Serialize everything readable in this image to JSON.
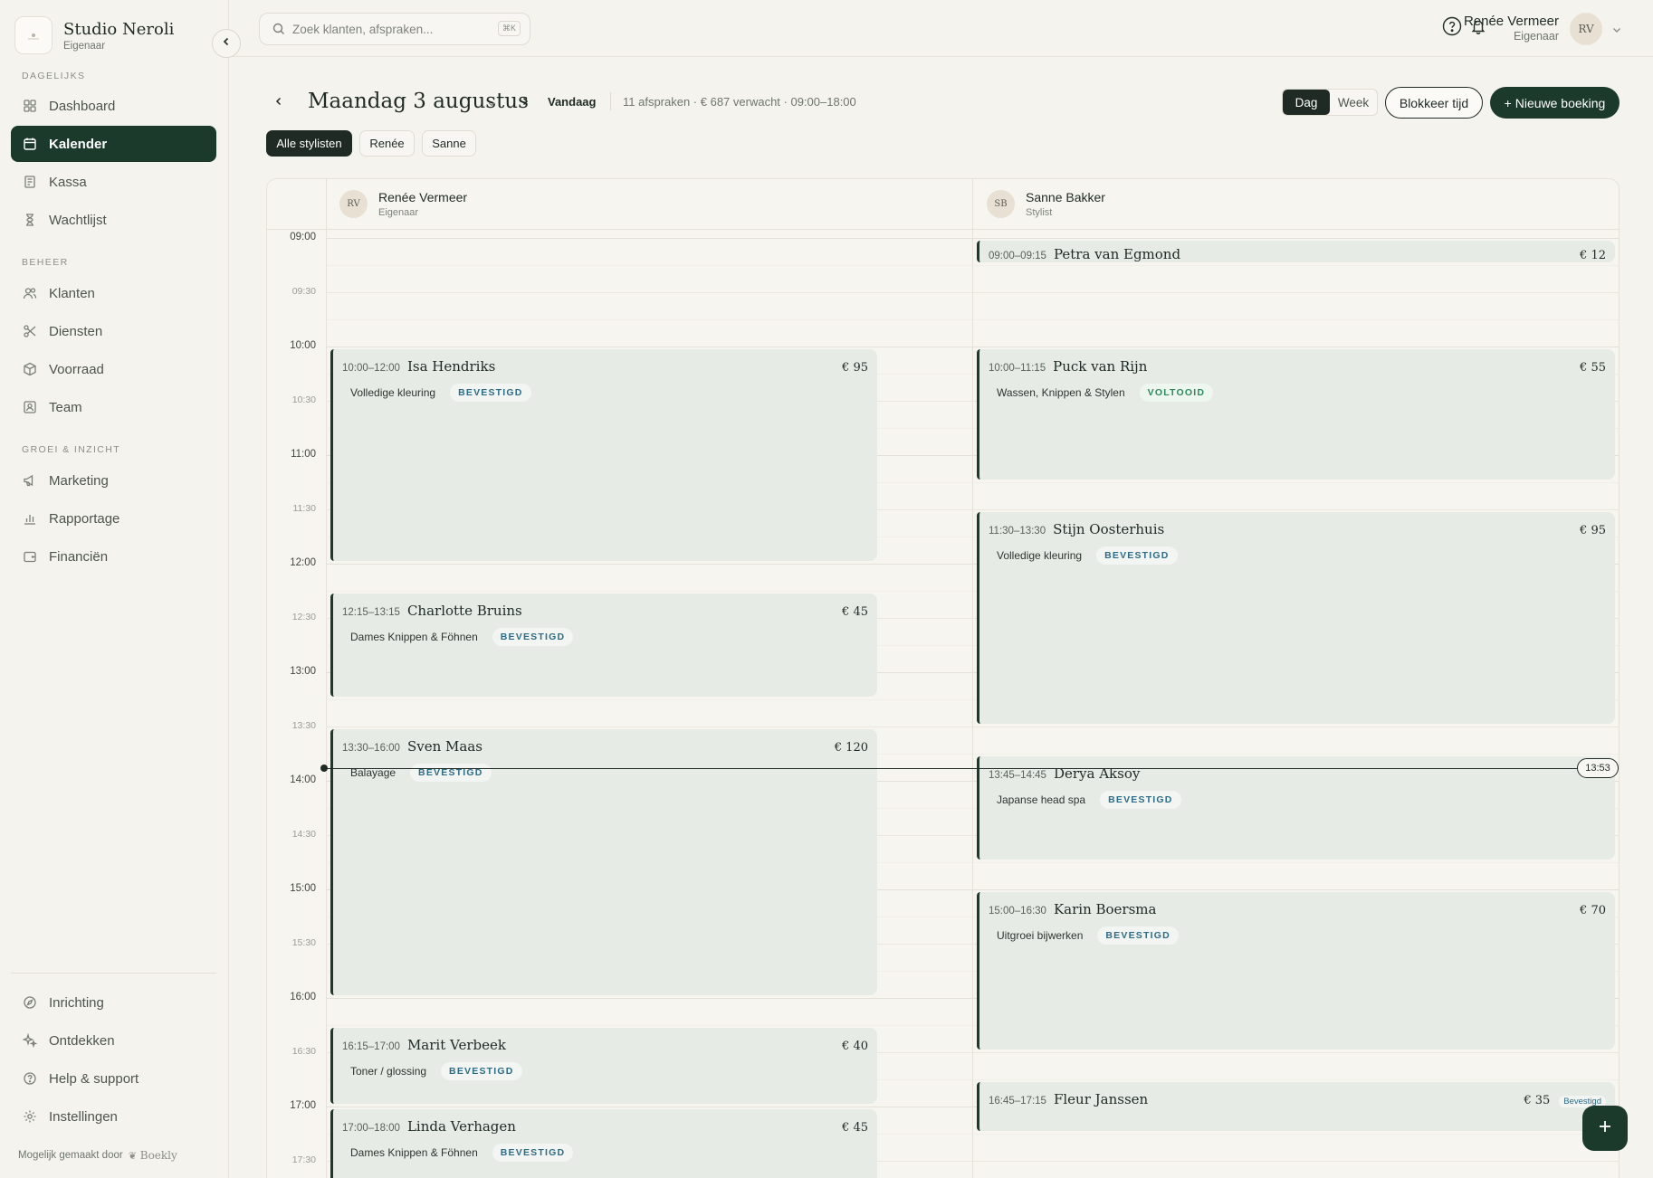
{
  "brand": {
    "name": "Studio Neroli",
    "role": "Eigenaar"
  },
  "sidebar": {
    "sections": [
      "DAGELIJKS",
      "BEHEER",
      "GROEI & INZICHT"
    ],
    "items": [
      {
        "label": "Dashboard",
        "icon": "grid-icon"
      },
      {
        "label": "Kalender",
        "icon": "calendar-icon"
      },
      {
        "label": "Kassa",
        "icon": "register-icon"
      },
      {
        "label": "Wachtlijst",
        "icon": "hourglass-icon"
      },
      {
        "label": "Klanten",
        "icon": "users-icon"
      },
      {
        "label": "Diensten",
        "icon": "scissors-icon"
      },
      {
        "label": "Voorraad",
        "icon": "box-icon"
      },
      {
        "label": "Team",
        "icon": "id-card-icon"
      },
      {
        "label": "Marketing",
        "icon": "megaphone-icon"
      },
      {
        "label": "Rapportage",
        "icon": "bar-chart-icon"
      },
      {
        "label": "Financiën",
        "icon": "wallet-icon"
      }
    ],
    "bottom": [
      {
        "label": "Inrichting",
        "icon": "compass-icon"
      },
      {
        "label": "Ontdekken",
        "icon": "sparkle-icon"
      },
      {
        "label": "Help & support",
        "icon": "help-icon"
      },
      {
        "label": "Instellingen",
        "icon": "gear-icon"
      }
    ],
    "made_by": "Mogelijk gemaakt door",
    "made_by_brand": "Boekly"
  },
  "search": {
    "placeholder": "Zoek klanten, afspraken...",
    "shortcut": "⌘K"
  },
  "user": {
    "name": "Renée Vermeer",
    "role": "Eigenaar",
    "initials": "RV"
  },
  "header": {
    "date": "Maandag 3 augustus",
    "today": "Vandaag",
    "summary": "11 afspraken · € 687 verwacht · 09:00–18:00",
    "views": [
      "Dag",
      "Week"
    ],
    "active_view": "Dag",
    "block_time": "Blokkeer tijd",
    "new_booking": "+ Nieuwe boeking"
  },
  "filters": [
    "Alle stylisten",
    "Renée",
    "Sanne"
  ],
  "staff": [
    {
      "initials": "RV",
      "name": "Renée Vermeer",
      "role": "Eigenaar"
    },
    {
      "initials": "SB",
      "name": "Sanne Bakker",
      "role": "Stylist"
    }
  ],
  "time_labels": [
    "09:00",
    "09:30",
    "10:00",
    "10:30",
    "11:00",
    "11:30",
    "12:00",
    "12:30",
    "13:00",
    "13:30",
    "14:00",
    "14:30",
    "15:00",
    "15:30",
    "16:00",
    "16:30",
    "17:00",
    "17:30"
  ],
  "now": "13:53",
  "appointments": [
    {
      "col": 0,
      "start": 10.0,
      "end": 12.0,
      "time": "10:00–12:00",
      "client": "Isa Hendriks",
      "price": "€ 95",
      "service": "Volledige kleuring",
      "status": "BEVESTIGD",
      "status_type": "ok"
    },
    {
      "col": 0,
      "start": 12.25,
      "end": 13.25,
      "time": "12:15–13:15",
      "client": "Charlotte Bruins",
      "price": "€ 45",
      "service": "Dames Knippen & Föhnen",
      "status": "BEVESTIGD",
      "status_type": "ok"
    },
    {
      "col": 0,
      "start": 13.5,
      "end": 16.0,
      "time": "13:30–16:00",
      "client": "Sven Maas",
      "price": "€ 120",
      "service": "Balayage",
      "status": "BEVESTIGD",
      "status_type": "ok"
    },
    {
      "col": 0,
      "start": 16.25,
      "end": 17.0,
      "time": "16:15–17:00",
      "client": "Marit Verbeek",
      "price": "€ 40",
      "service": "Toner / glossing",
      "status": "BEVESTIGD",
      "status_type": "ok"
    },
    {
      "col": 0,
      "start": 17.0,
      "end": 18.0,
      "time": "17:00–18:00",
      "client": "Linda Verhagen",
      "price": "€ 45",
      "service": "Dames Knippen & Föhnen",
      "status": "BEVESTIGD",
      "status_type": "ok"
    },
    {
      "col": 1,
      "start": 9.0,
      "end": 9.25,
      "time": "09:00–09:15",
      "client": "Petra van Egmond",
      "price": "€ 12",
      "service": "",
      "status": "",
      "status_type": ""
    },
    {
      "col": 1,
      "start": 10.0,
      "end": 11.25,
      "time": "10:00–11:15",
      "client": "Puck van Rijn",
      "price": "€ 55",
      "service": "Wassen, Knippen & Stylen",
      "status": "VOLTOOID",
      "status_type": "done"
    },
    {
      "col": 1,
      "start": 11.5,
      "end": 13.5,
      "time": "11:30–13:30",
      "client": "Stijn Oosterhuis",
      "price": "€ 95",
      "service": "Volledige kleuring",
      "status": "BEVESTIGD",
      "status_type": "ok"
    },
    {
      "col": 1,
      "start": 13.75,
      "end": 14.75,
      "time": "13:45–14:45",
      "client": "Derya Aksoy",
      "price": "",
      "service": "Japanse head spa",
      "status": "BEVESTIGD",
      "status_type": "ok"
    },
    {
      "col": 1,
      "start": 15.0,
      "end": 16.5,
      "time": "15:00–16:30",
      "client": "Karin Boersma",
      "price": "€ 70",
      "service": "Uitgroei bijwerken",
      "status": "BEVESTIGD",
      "status_type": "ok"
    },
    {
      "col": 1,
      "start": 16.75,
      "end": 17.25,
      "time": "16:45–17:15",
      "client": "Fleur Janssen",
      "price": "€ 35",
      "service": "",
      "status": "Bevestigd",
      "status_type": "mini"
    }
  ],
  "colors": {
    "accent": "#1c3a2b",
    "background": "#f5f3ee",
    "appointment": "#e6ebe5",
    "status_ok": "#2e6c86",
    "status_done": "#2e8a5b"
  }
}
